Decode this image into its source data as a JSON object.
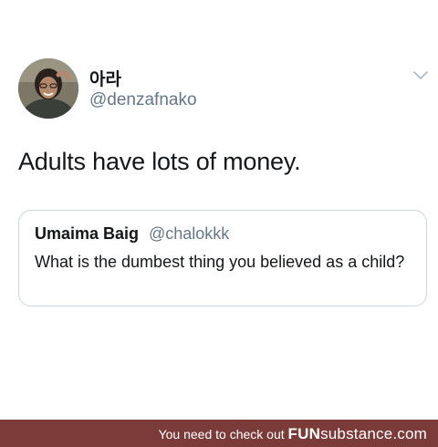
{
  "tweet": {
    "display_name": "아라",
    "handle": "@denzafnako",
    "text": "Adults have lots of money."
  },
  "quoted_tweet": {
    "name": "Umaima Baig",
    "handle": "@chalokkk",
    "text": "What is the dumbest thing you believed as a child?"
  },
  "watermark": {
    "prefix": "You need to check out",
    "brand_part1": "FUN",
    "brand_part2": "substance",
    "brand_part3": ".com"
  },
  "colors": {
    "text_primary": "#14171a",
    "text_secondary": "#657786",
    "border": "#ccd6dd",
    "footer_bg": "#7a3b39"
  },
  "icons": {
    "menu": "chevron-down-icon"
  }
}
